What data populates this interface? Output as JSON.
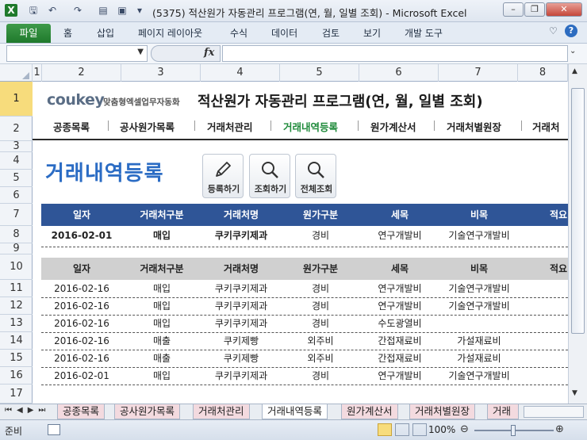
{
  "window": {
    "title": "(5375) 적산원가 자동관리 프로그램(연, 월, 일별 조회) - Microsoft Excel"
  },
  "ribbon": {
    "file": "파일",
    "tabs": [
      "홈",
      "삽입",
      "페이지 레이아웃",
      "수식",
      "데이터",
      "검토",
      "보기",
      "개발 도구"
    ]
  },
  "formula_bar": {
    "fx": "fx",
    "name_box": "",
    "formula": ""
  },
  "columns": [
    "1",
    "2",
    "3",
    "4",
    "5",
    "6",
    "7",
    "8"
  ],
  "rows": [
    "1",
    "2",
    "3",
    "4",
    "5",
    "6",
    "7",
    "8",
    "9",
    "10",
    "11",
    "12",
    "13",
    "14",
    "15",
    "16",
    "17"
  ],
  "logo": {
    "brand": "coukey",
    "subtitle": "맞춤형엑셀업무자동화"
  },
  "page_title": "적산원가 자동관리 프로그램(연, 월, 일별 조회)",
  "nav": [
    "공종목록",
    "공사원가목록",
    "거래처관리",
    "거래내역등록",
    "원가계산서",
    "거래처별원장",
    "거래처"
  ],
  "section_title": "거래내역등록",
  "buttons": {
    "register": "등록하기",
    "search": "조회하기",
    "search_all": "전체조회"
  },
  "input_header": [
    "일자",
    "거래처구분",
    "거래처명",
    "원가구분",
    "세목",
    "비목",
    "적요"
  ],
  "input_row": [
    "2016-02-01",
    "매입",
    "쿠키쿠키제과",
    "경비",
    "연구개발비",
    "기술연구개발비",
    ""
  ],
  "list_header": [
    "일자",
    "거래처구분",
    "거래처명",
    "원가구분",
    "세목",
    "비목",
    "적요"
  ],
  "list_rows": [
    [
      "2016-02-16",
      "매입",
      "쿠키쿠키제과",
      "경비",
      "연구개발비",
      "기술연구개발비",
      ""
    ],
    [
      "2016-02-16",
      "매입",
      "쿠키쿠키제과",
      "경비",
      "연구개발비",
      "기술연구개발비",
      ""
    ],
    [
      "2016-02-16",
      "매입",
      "쿠키쿠키제과",
      "경비",
      "수도광열비",
      "",
      ""
    ],
    [
      "2016-02-16",
      "매출",
      "쿠키제빵",
      "외주비",
      "간접재료비",
      "가설재료비",
      ""
    ],
    [
      "2016-02-16",
      "매출",
      "쿠키제빵",
      "외주비",
      "간접재료비",
      "가설재료비",
      ""
    ],
    [
      "2016-02-01",
      "매입",
      "쿠키쿠키제과",
      "경비",
      "연구개발비",
      "기술연구개발비",
      ""
    ]
  ],
  "sheet_tabs": [
    "공종목록",
    "공사원가목록",
    "거래처관리",
    "거래내역등록",
    "원가계산서",
    "거래처별원장",
    "거래"
  ],
  "status": {
    "ready": "준비",
    "zoom": "100%"
  },
  "colors": {
    "accent": "#2f5597",
    "nav_active": "#1e8a3a",
    "title_blue": "#2b6cc4",
    "excel_green": "#1f7a2c"
  }
}
